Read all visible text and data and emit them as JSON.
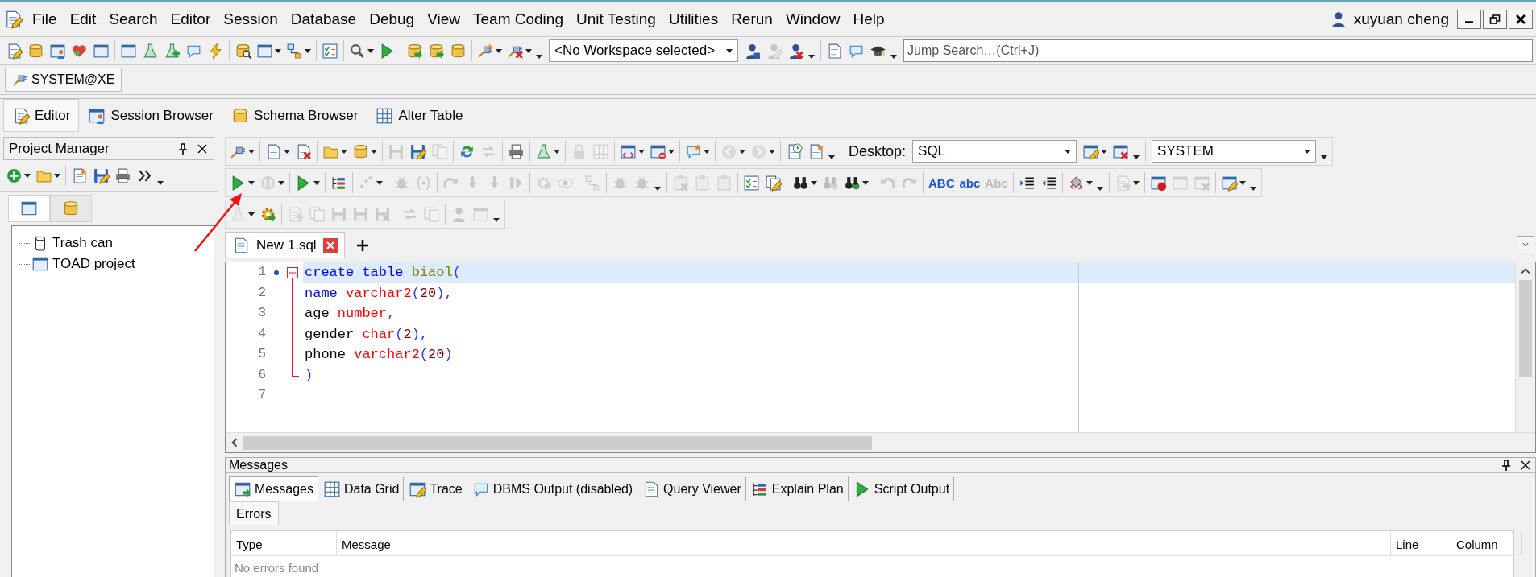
{
  "menu_bar": {
    "items": [
      "File",
      "Edit",
      "Search",
      "Editor",
      "Session",
      "Database",
      "Debug",
      "View",
      "Team Coding",
      "Unit Testing",
      "Utilities",
      "Rerun",
      "Window",
      "Help"
    ],
    "user": "xuyuan cheng"
  },
  "main_toolbar": [
    {
      "kind": "button",
      "disabled": false
    },
    {
      "kind": "button",
      "disabled": false
    },
    {
      "kind": "button",
      "disabled": false
    },
    {
      "kind": "button",
      "disabled": false
    },
    {
      "kind": "button",
      "disabled": false
    },
    {
      "kind": "separator"
    },
    {
      "kind": "button",
      "disabled": false
    },
    {
      "kind": "button",
      "disabled": false
    },
    {
      "kind": "button",
      "disabled": false
    },
    {
      "kind": "button",
      "disabled": false
    },
    {
      "kind": "button",
      "disabled": false
    },
    {
      "kind": "separator"
    },
    {
      "kind": "button",
      "disabled": false
    },
    {
      "kind": "split_button",
      "disabled": false
    },
    {
      "kind": "split_button",
      "disabled": false
    },
    {
      "kind": "separator"
    },
    {
      "kind": "button",
      "disabled": false
    },
    {
      "kind": "separator"
    },
    {
      "kind": "split_button",
      "disabled": false
    },
    {
      "kind": "button",
      "disabled": false
    },
    {
      "kind": "separator"
    },
    {
      "kind": "button",
      "disabled": false
    },
    {
      "kind": "button",
      "disabled": false
    },
    {
      "kind": "button",
      "disabled": false
    },
    {
      "kind": "separator"
    },
    {
      "kind": "split_button",
      "disabled": false
    },
    {
      "kind": "split_button",
      "disabled": false
    },
    {
      "kind": "overflow"
    },
    {
      "kind": "combo",
      "value": "<No Workspace selected>"
    },
    {
      "kind": "button",
      "disabled": false
    },
    {
      "kind": "button",
      "disabled": true
    },
    {
      "kind": "button",
      "disabled": false
    },
    {
      "kind": "overflow"
    },
    {
      "kind": "separator"
    },
    {
      "kind": "button",
      "disabled": false
    },
    {
      "kind": "button",
      "disabled": false
    },
    {
      "kind": "button",
      "disabled": false
    },
    {
      "kind": "overflow"
    },
    {
      "kind": "search",
      "placeholder": "Jump Search…(Ctrl+J)"
    }
  ],
  "connection_tab": {
    "label": "SYSTEM@XE",
    "selected": true
  },
  "main_tabs": [
    {
      "label": "Editor",
      "selected": true
    },
    {
      "label": "Session Browser",
      "selected": false
    },
    {
      "label": "Schema Browser",
      "selected": false
    },
    {
      "label": "Alter Table",
      "selected": false
    }
  ],
  "project_manager": {
    "title": "Project Manager",
    "toolbar": [
      {
        "kind": "split_button",
        "disabled": false
      },
      {
        "kind": "split_button",
        "disabled": false
      },
      {
        "kind": "separator"
      },
      {
        "kind": "button",
        "disabled": false
      },
      {
        "kind": "button",
        "disabled": false
      },
      {
        "kind": "button",
        "disabled": false
      },
      {
        "kind": "button",
        "disabled": false
      },
      {
        "kind": "overflow"
      }
    ],
    "tabs": [
      {
        "selected": true
      },
      {
        "selected": false
      }
    ],
    "tree": [
      {
        "label": "Trash can"
      },
      {
        "label": "TOAD project"
      }
    ]
  },
  "editor": {
    "toolbars": [
      [
        {
          "kind": "split_button",
          "disabled": false
        },
        {
          "kind": "separator"
        },
        {
          "kind": "split_button",
          "disabled": false
        },
        {
          "kind": "button",
          "disabled": false
        },
        {
          "kind": "separator"
        },
        {
          "kind": "split_button",
          "disabled": false
        },
        {
          "kind": "split_button",
          "disabled": false
        },
        {
          "kind": "separator"
        },
        {
          "kind": "button",
          "disabled": true
        },
        {
          "kind": "button",
          "disabled": false
        },
        {
          "kind": "button",
          "disabled": true
        },
        {
          "kind": "separator"
        },
        {
          "kind": "button",
          "disabled": false
        },
        {
          "kind": "button",
          "disabled": true
        },
        {
          "kind": "separator"
        },
        {
          "kind": "button",
          "disabled": false
        },
        {
          "kind": "separator"
        },
        {
          "kind": "split_button",
          "disabled": false
        },
        {
          "kind": "separator"
        },
        {
          "kind": "button",
          "disabled": true
        },
        {
          "kind": "button",
          "disabled": true
        },
        {
          "kind": "separator"
        },
        {
          "kind": "split_button",
          "disabled": false
        },
        {
          "kind": "split_button",
          "disabled": false
        },
        {
          "kind": "separator"
        },
        {
          "kind": "split_button",
          "disabled": false
        },
        {
          "kind": "separator"
        },
        {
          "kind": "split_button",
          "disabled": true
        },
        {
          "kind": "split_button",
          "disabled": true
        },
        {
          "kind": "separator"
        },
        {
          "kind": "button",
          "disabled": false
        },
        {
          "kind": "button",
          "disabled": false
        },
        {
          "kind": "overflow"
        },
        {
          "kind": "separator"
        },
        {
          "kind": "label",
          "text": "Desktop:"
        },
        {
          "kind": "combo",
          "value": "SQL"
        },
        {
          "kind": "split_button",
          "disabled": false
        },
        {
          "kind": "button",
          "disabled": false
        },
        {
          "kind": "overflow"
        },
        {
          "kind": "separator"
        },
        {
          "kind": "combo",
          "value": "SYSTEM"
        },
        {
          "kind": "overflow"
        }
      ],
      [
        {
          "kind": "split_button",
          "disabled": false
        },
        {
          "kind": "split_button",
          "disabled": true
        },
        {
          "kind": "separator"
        },
        {
          "kind": "split_button",
          "disabled": false
        },
        {
          "kind": "separator"
        },
        {
          "kind": "button",
          "disabled": false
        },
        {
          "kind": "separator"
        },
        {
          "kind": "split_button",
          "disabled": true
        },
        {
          "kind": "separator"
        },
        {
          "kind": "button",
          "disabled": true
        },
        {
          "kind": "button",
          "disabled": true
        },
        {
          "kind": "separator"
        },
        {
          "kind": "button",
          "disabled": true
        },
        {
          "kind": "button",
          "disabled": true
        },
        {
          "kind": "button",
          "disabled": true
        },
        {
          "kind": "button",
          "disabled": true
        },
        {
          "kind": "separator"
        },
        {
          "kind": "button",
          "disabled": true
        },
        {
          "kind": "button",
          "disabled": true
        },
        {
          "kind": "separator"
        },
        {
          "kind": "button",
          "disabled": true
        },
        {
          "kind": "separator"
        },
        {
          "kind": "button",
          "disabled": true
        },
        {
          "kind": "button",
          "disabled": true
        },
        {
          "kind": "overflow"
        },
        {
          "kind": "separator"
        },
        {
          "kind": "button",
          "disabled": true
        },
        {
          "kind": "button",
          "disabled": true
        },
        {
          "kind": "button",
          "disabled": true
        },
        {
          "kind": "separator"
        },
        {
          "kind": "button",
          "disabled": false
        },
        {
          "kind": "button",
          "disabled": false
        },
        {
          "kind": "separator"
        },
        {
          "kind": "split_button",
          "disabled": false
        },
        {
          "kind": "button",
          "disabled": true
        },
        {
          "kind": "split_button",
          "disabled": false
        },
        {
          "kind": "separator"
        },
        {
          "kind": "button",
          "disabled": true
        },
        {
          "kind": "button",
          "disabled": true
        },
        {
          "kind": "separator"
        },
        {
          "kind": "text_button",
          "label": "ABC",
          "disabled": false
        },
        {
          "kind": "text_button",
          "label": "abc",
          "disabled": false
        },
        {
          "kind": "text_button",
          "label": "Abc",
          "disabled": true
        },
        {
          "kind": "separator"
        },
        {
          "kind": "button",
          "disabled": false
        },
        {
          "kind": "button",
          "disabled": false
        },
        {
          "kind": "separator"
        },
        {
          "kind": "split_button",
          "disabled": false
        },
        {
          "kind": "overflow"
        },
        {
          "kind": "separator"
        },
        {
          "kind": "split_button",
          "disabled": true
        },
        {
          "kind": "separator"
        },
        {
          "kind": "button",
          "disabled": false
        },
        {
          "kind": "button",
          "disabled": true
        },
        {
          "kind": "button",
          "disabled": true
        },
        {
          "kind": "separator"
        },
        {
          "kind": "split_button",
          "disabled": false
        },
        {
          "kind": "overflow"
        }
      ],
      [
        {
          "kind": "split_button",
          "disabled": true
        },
        {
          "kind": "button",
          "disabled": false
        },
        {
          "kind": "separator"
        },
        {
          "kind": "button",
          "disabled": true
        },
        {
          "kind": "button",
          "disabled": true
        },
        {
          "kind": "button",
          "disabled": true
        },
        {
          "kind": "button",
          "disabled": true
        },
        {
          "kind": "button",
          "disabled": true
        },
        {
          "kind": "separator"
        },
        {
          "kind": "button",
          "disabled": true
        },
        {
          "kind": "button",
          "disabled": true
        },
        {
          "kind": "separator"
        },
        {
          "kind": "button",
          "disabled": true
        },
        {
          "kind": "button",
          "disabled": true
        },
        {
          "kind": "overflow"
        }
      ]
    ],
    "tabs": [
      {
        "label": "New 1.sql",
        "selected": true
      }
    ],
    "lines": [
      {
        "number": "1",
        "current": true,
        "marked": true,
        "kind": "fold_start",
        "tokens": [
          {
            "text": "create ",
            "kind": "keyword"
          },
          {
            "text": "table ",
            "kind": "keyword"
          },
          {
            "text": "biaol",
            "kind": "name"
          },
          {
            "text": "(",
            "kind": "punct"
          }
        ]
      },
      {
        "number": "2",
        "current": false,
        "marked": false,
        "kind": "fold_body",
        "tokens": [
          {
            "text": "name ",
            "kind": "keyword"
          },
          {
            "text": "varchar2",
            "kind": "type"
          },
          {
            "text": "(",
            "kind": "punct"
          },
          {
            "text": "20",
            "kind": "number"
          },
          {
            "text": "),",
            "kind": "punct"
          }
        ]
      },
      {
        "number": "3",
        "current": false,
        "marked": false,
        "kind": "fold_body",
        "tokens": [
          {
            "text": "age ",
            "kind": "plain"
          },
          {
            "text": "number",
            "kind": "type"
          },
          {
            "text": ",",
            "kind": "punct"
          }
        ]
      },
      {
        "number": "4",
        "current": false,
        "marked": false,
        "kind": "fold_body",
        "tokens": [
          {
            "text": "gender ",
            "kind": "plain"
          },
          {
            "text": "char",
            "kind": "type"
          },
          {
            "text": "(",
            "kind": "punct"
          },
          {
            "text": "2",
            "kind": "number"
          },
          {
            "text": "),",
            "kind": "punct"
          }
        ]
      },
      {
        "number": "5",
        "current": false,
        "marked": false,
        "kind": "fold_body",
        "tokens": [
          {
            "text": "phone ",
            "kind": "plain"
          },
          {
            "text": "varchar2",
            "kind": "type"
          },
          {
            "text": "(",
            "kind": "punct"
          },
          {
            "text": "20",
            "kind": "number"
          },
          {
            "text": ")",
            "kind": "punct"
          }
        ]
      },
      {
        "number": "6",
        "current": false,
        "marked": false,
        "kind": "fold_end",
        "tokens": [
          {
            "text": ")",
            "kind": "punct"
          }
        ]
      },
      {
        "number": "7",
        "current": false,
        "marked": false,
        "kind": "plain"
      }
    ]
  },
  "messages": {
    "title": "Messages",
    "tabs": [
      {
        "label": "Messages",
        "selected": true
      },
      {
        "label": "Data Grid",
        "selected": false
      },
      {
        "label": "Trace",
        "selected": false
      },
      {
        "label": "DBMS Output (disabled)",
        "selected": false
      },
      {
        "label": "Query Viewer",
        "selected": false
      },
      {
        "label": "Explain Plan",
        "selected": false
      },
      {
        "label": "Script Output",
        "selected": false
      }
    ],
    "subtabs": [
      {
        "label": "Errors",
        "selected": true
      }
    ],
    "columns": [
      "Type",
      "Message",
      "Line",
      "Column"
    ],
    "empty_text": "No errors found"
  }
}
